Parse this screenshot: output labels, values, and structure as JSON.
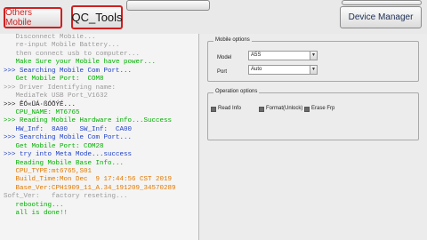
{
  "toolbar": {
    "others_mobile": "Others Mobile",
    "qc_tools": "QC_Tools",
    "device_manager": "Device Manager"
  },
  "log": [
    {
      "text": "   Disconnect Mobile...",
      "color": "gray"
    },
    {
      "text": "   re-input Mobile Battery...",
      "color": "gray"
    },
    {
      "text": "   then connect usb to computer...",
      "color": "gray"
    },
    {
      "text": "   Make Sure your Mobile have power...",
      "color": "green"
    },
    {
      "text": ">>> Searching Mobile Com Port...",
      "color": "blue"
    },
    {
      "text": "   Get Mobile Port:  COM8",
      "color": "green"
    },
    {
      "text": ">>> Driver Identifying name:",
      "color": "gray"
    },
    {
      "text": "   MediaTek USB Port_V1632",
      "color": "gray"
    },
    {
      "text": ">>> ÊÓ«ÜÁ·ßÓÕÝÉ...",
      "color": "black"
    },
    {
      "text": "   CPU_NAME: MT6765",
      "color": "green"
    },
    {
      "text": ">>> Reading Mobile Hardware info...Success",
      "color": "green"
    },
    {
      "text": "   HW_Inf:  8A00   SW_Inf:  CA00",
      "color": "blue"
    },
    {
      "text": ">>> Searching Mobile Com Port...",
      "color": "blue"
    },
    {
      "text": "   Get Mobile Port: COM28",
      "color": "green"
    },
    {
      "text": ">>> try into Meta Mode...success",
      "color": "blue"
    },
    {
      "text": "   Reading Mobile Base Info...",
      "color": "green"
    },
    {
      "text": "   CPU_TYPE:mt6765,S01",
      "color": "orange"
    },
    {
      "text": "   Build_Time:Mon Dec  9 17:44:56 CST 2019",
      "color": "orange"
    },
    {
      "text": "   Base_Ver:CPH1909_11_A.34_191209_34570289",
      "color": "orange"
    },
    {
      "text": "Soft_Ver:   factory reseting...",
      "color": "gray"
    },
    {
      "text": "   rebooting...",
      "color": "green"
    },
    {
      "text": "   all is done!!",
      "color": "green"
    }
  ],
  "mobile_options": {
    "title": "Mobile options",
    "model_label": "Model",
    "model_value": "A5S",
    "port_label": "Port",
    "port_value": "Auto"
  },
  "operation_options": {
    "title": "Operation options",
    "read_info": "Read Info",
    "format_unlock": "Format(Unlock)",
    "erase_frp": "Erase Frp"
  }
}
